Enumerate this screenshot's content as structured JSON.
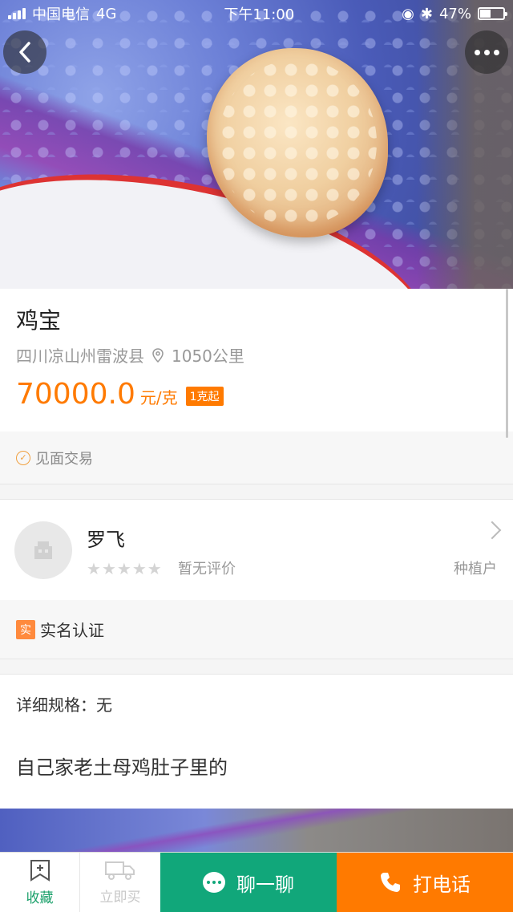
{
  "status_bar": {
    "carrier": "中国电信",
    "network": "4G",
    "time": "下午11:00",
    "battery": "47%"
  },
  "product": {
    "title": "鸡宝",
    "location": "四川凉山州雷波县",
    "distance": "1050公里",
    "price": "70000.0",
    "unit": "元/克",
    "min_order": "1克起",
    "trade_method": "见面交易"
  },
  "seller": {
    "name": "罗飞",
    "rating_text": "暂无评价",
    "rating_stars": 0,
    "role": "种植户",
    "verify_badge": "实",
    "verify_text": "实名认证"
  },
  "details": {
    "spec": "详细规格：无",
    "description": "自己家老土母鸡肚子里的"
  },
  "bottom_bar": {
    "favorite": "收藏",
    "buy_now": "立即买",
    "chat": "聊一聊",
    "call": "打电话"
  },
  "colors": {
    "accent_orange": "#ff7a00",
    "accent_green": "#11a77a"
  }
}
